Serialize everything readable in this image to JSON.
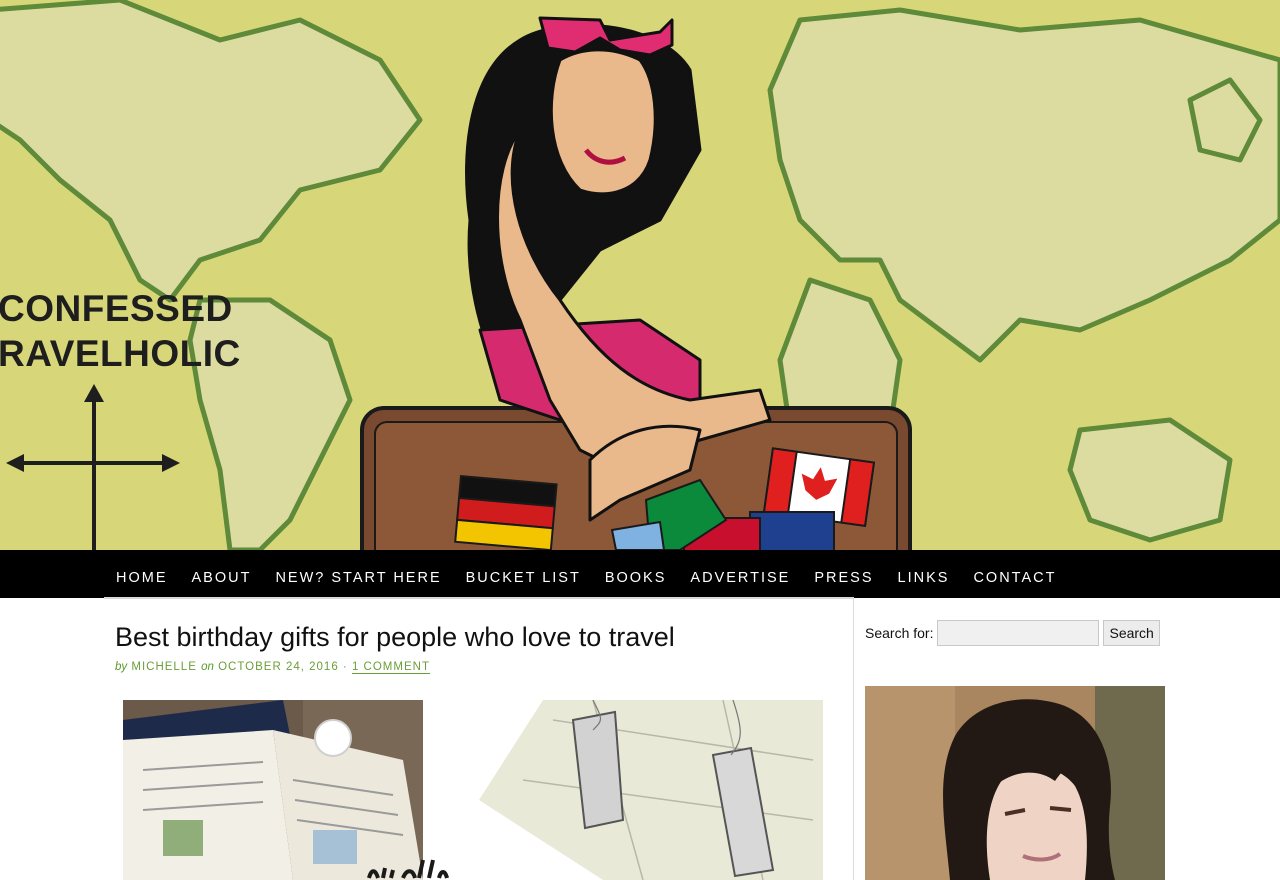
{
  "header": {
    "brand_line1": "CONFESSED",
    "brand_line2": "RAVELHOLIC"
  },
  "nav": {
    "items": [
      "HOME",
      "ABOUT",
      "NEW? START HERE",
      "BUCKET LIST",
      "BOOKS",
      "ADVERTISE",
      "PRESS",
      "LINKS",
      "CONTACT"
    ]
  },
  "post": {
    "title": "Best birthday gifts for people who love to travel",
    "by_label": "by",
    "author": "MICHELLE",
    "on_label": "on",
    "date": "OCTOBER 24, 2016",
    "separator": "·",
    "comments": "1 COMMENT"
  },
  "sidebar": {
    "search_label": "Search for:",
    "search_value": "",
    "search_button": "Search"
  },
  "colors": {
    "banner_bg": "#d7d77a",
    "map_land": "#dcdca0",
    "map_outline": "#5e8a3a",
    "nav_bg": "#000000",
    "link_green": "#6b9e3a"
  }
}
